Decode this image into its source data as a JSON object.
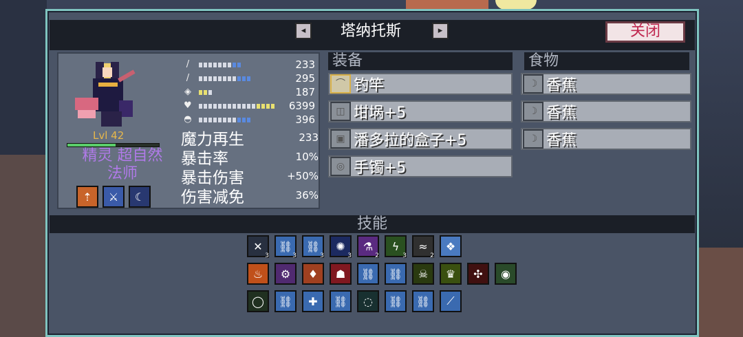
{
  "header": {
    "character_name": "塔纳托斯",
    "prev_label": "◂",
    "next_label": "▸",
    "close_label": "关闭"
  },
  "character": {
    "level_text": "Lvl 42",
    "level_progress": 0.53,
    "class_line1": "精灵 超自然",
    "class_line2": "法师",
    "perks": [
      {
        "icon": "axe-upgrade-icon",
        "color": "#c8642a",
        "glyph": "⇡"
      },
      {
        "icon": "shield-sword-icon",
        "color": "#3a5aa8",
        "glyph": "⚔"
      },
      {
        "icon": "moon-icon",
        "color": "#283870",
        "glyph": "☾"
      }
    ],
    "stats": [
      {
        "icon": "sword-icon",
        "glyph": "/",
        "value": "233",
        "fill": 9,
        "colors": "wwwwwwwbb"
      },
      {
        "icon": "wand-icon",
        "glyph": "/",
        "value": "295",
        "fill": 11,
        "colors": "wwwwwwwwbbb"
      },
      {
        "icon": "shield-icon",
        "glyph": "◈",
        "value": "187",
        "fill": 3,
        "colors": "yyw"
      },
      {
        "icon": "heart-icon",
        "glyph": "♥",
        "value": "6399",
        "fill": 16,
        "colors": "wwwwwwwwwwwwyyyy"
      },
      {
        "icon": "potion-icon",
        "glyph": "◓",
        "value": "396",
        "fill": 11,
        "colors": "wwwwwwwwbbb"
      }
    ],
    "substats": [
      {
        "label": "魔力再生",
        "value": "233"
      },
      {
        "label": "暴击率",
        "value": "10%"
      },
      {
        "label": "暴击伤害",
        "value": "+50%"
      },
      {
        "label": "伤害减免",
        "value": "36%"
      }
    ]
  },
  "equipment": {
    "header": "装备",
    "items": [
      {
        "label": "钓竿",
        "icon": "fishing-rod-icon",
        "glyph": "⌒",
        "gold": true
      },
      {
        "label": "坩埚+5",
        "icon": "cauldron-icon",
        "glyph": "◫",
        "gold": false
      },
      {
        "label": "潘多拉的盒子+5",
        "icon": "box-icon",
        "glyph": "▣",
        "gold": false
      },
      {
        "label": "手镯+5",
        "icon": "bracelet-icon",
        "glyph": "◎",
        "gold": false
      }
    ]
  },
  "food": {
    "header": "食物",
    "items": [
      {
        "label": "香蕉",
        "icon": "banana-icon",
        "glyph": "☽"
      },
      {
        "label": "香蕉",
        "icon": "banana-icon",
        "glyph": "☽"
      },
      {
        "label": "香蕉",
        "icon": "banana-icon",
        "glyph": "☽"
      }
    ]
  },
  "skills": {
    "header": "技能",
    "rows": [
      [
        {
          "icon": "cross-blades-icon",
          "color": "#283040",
          "glyph": "✕",
          "count": "3"
        },
        {
          "icon": "chain-icon",
          "color": "#3a6ab0",
          "glyph": "⛓",
          "count": "3"
        },
        {
          "icon": "chain-icon",
          "color": "#3a6ab0",
          "glyph": "⛓",
          "count": "3"
        },
        {
          "icon": "blue-flame-icon",
          "color": "#1c2a60",
          "glyph": "✺",
          "count": "3"
        },
        {
          "icon": "poison-flask-icon",
          "color": "#5a2a80",
          "glyph": "⚗",
          "count": "2"
        },
        {
          "icon": "green-bolt-icon",
          "color": "#2a5020",
          "glyph": "ϟ",
          "count": "3"
        },
        {
          "icon": "shadow-claw-icon",
          "color": "#303030",
          "glyph": "≈",
          "count": "2"
        },
        {
          "icon": "ice-crystal-icon",
          "color": "#4a7ac0",
          "glyph": "❖",
          "count": ""
        }
      ],
      [
        {
          "icon": "fire-icon",
          "color": "#c0501a",
          "glyph": "♨",
          "count": ""
        },
        {
          "icon": "gear-orb-icon",
          "color": "#502a70",
          "glyph": "⚙",
          "count": ""
        },
        {
          "icon": "heart-shield-icon",
          "color": "#a04020",
          "glyph": "♦",
          "count": ""
        },
        {
          "icon": "blood-bowl-icon",
          "color": "#801820",
          "glyph": "☗",
          "count": ""
        },
        {
          "icon": "chain-icon",
          "color": "#3a6ab0",
          "glyph": "⛓",
          "count": ""
        },
        {
          "icon": "chain-icon",
          "color": "#3a6ab0",
          "glyph": "⛓",
          "count": ""
        },
        {
          "icon": "skull-icon",
          "color": "#2a3a10",
          "glyph": "☠",
          "count": ""
        },
        {
          "icon": "crown-ring-icon",
          "color": "#3a5010",
          "glyph": "♛",
          "count": ""
        },
        {
          "icon": "red-cluster-icon",
          "color": "#401010",
          "glyph": "✣",
          "count": ""
        },
        {
          "icon": "red-eye-icon",
          "color": "#2a4a2a",
          "glyph": "◉",
          "count": ""
        }
      ],
      [
        {
          "icon": "green-ring-icon",
          "color": "#203020",
          "glyph": "◯",
          "count": ""
        },
        {
          "icon": "chain-icon",
          "color": "#3a6ab0",
          "glyph": "⛓",
          "count": ""
        },
        {
          "icon": "chain-plus-icon",
          "color": "#3a6ab0",
          "glyph": "✚",
          "count": ""
        },
        {
          "icon": "chain-icon",
          "color": "#3a6ab0",
          "glyph": "⛓",
          "count": ""
        },
        {
          "icon": "vortex-icon",
          "color": "#183030",
          "glyph": "◌",
          "count": ""
        },
        {
          "icon": "chain-red-icon",
          "color": "#3a6ab0",
          "glyph": "⛓",
          "count": ""
        },
        {
          "icon": "chain-icon",
          "color": "#3a6ab0",
          "glyph": "⛓",
          "count": ""
        },
        {
          "icon": "spear-icon",
          "color": "#3a6ab0",
          "glyph": "⟋",
          "count": ""
        }
      ]
    ]
  }
}
